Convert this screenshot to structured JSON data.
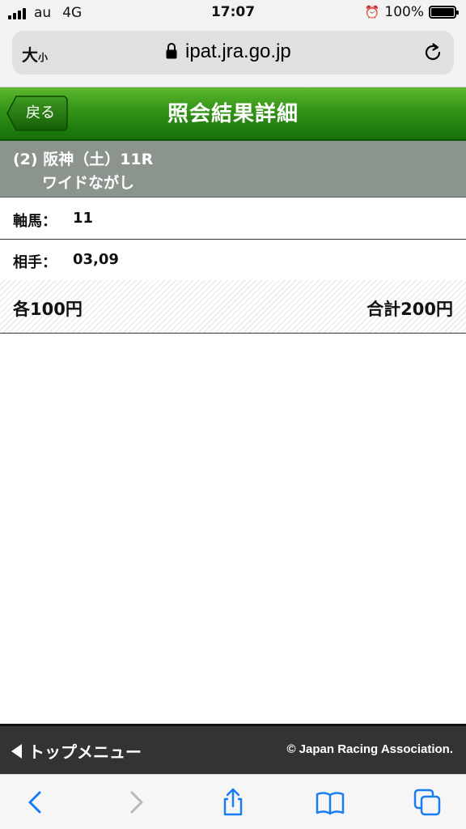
{
  "status_bar": {
    "carrier": "au",
    "network": "4G",
    "time": "17:07",
    "battery": "100%"
  },
  "browser": {
    "text_size_big": "大",
    "text_size_small": "小",
    "url": "ipat.jra.go.jp"
  },
  "header": {
    "back_label": "戻る",
    "title": "照会結果詳細"
  },
  "race": {
    "line1": "(2) 阪神（土）11R",
    "line2": "ワイドながし"
  },
  "details": {
    "axis_label": "軸馬：",
    "axis_value": "11",
    "partner_label": "相手：",
    "partner_value": "03,09"
  },
  "amount": {
    "each": "各100円",
    "total": "合計200円"
  },
  "footer": {
    "top_menu": "トップメニュー",
    "copyright": "© Japan Racing Association."
  },
  "colors": {
    "header_green": "#2f8f15",
    "race_gray": "#8c948e",
    "footer_dark": "#333333",
    "ios_blue": "#1a7cf5"
  }
}
